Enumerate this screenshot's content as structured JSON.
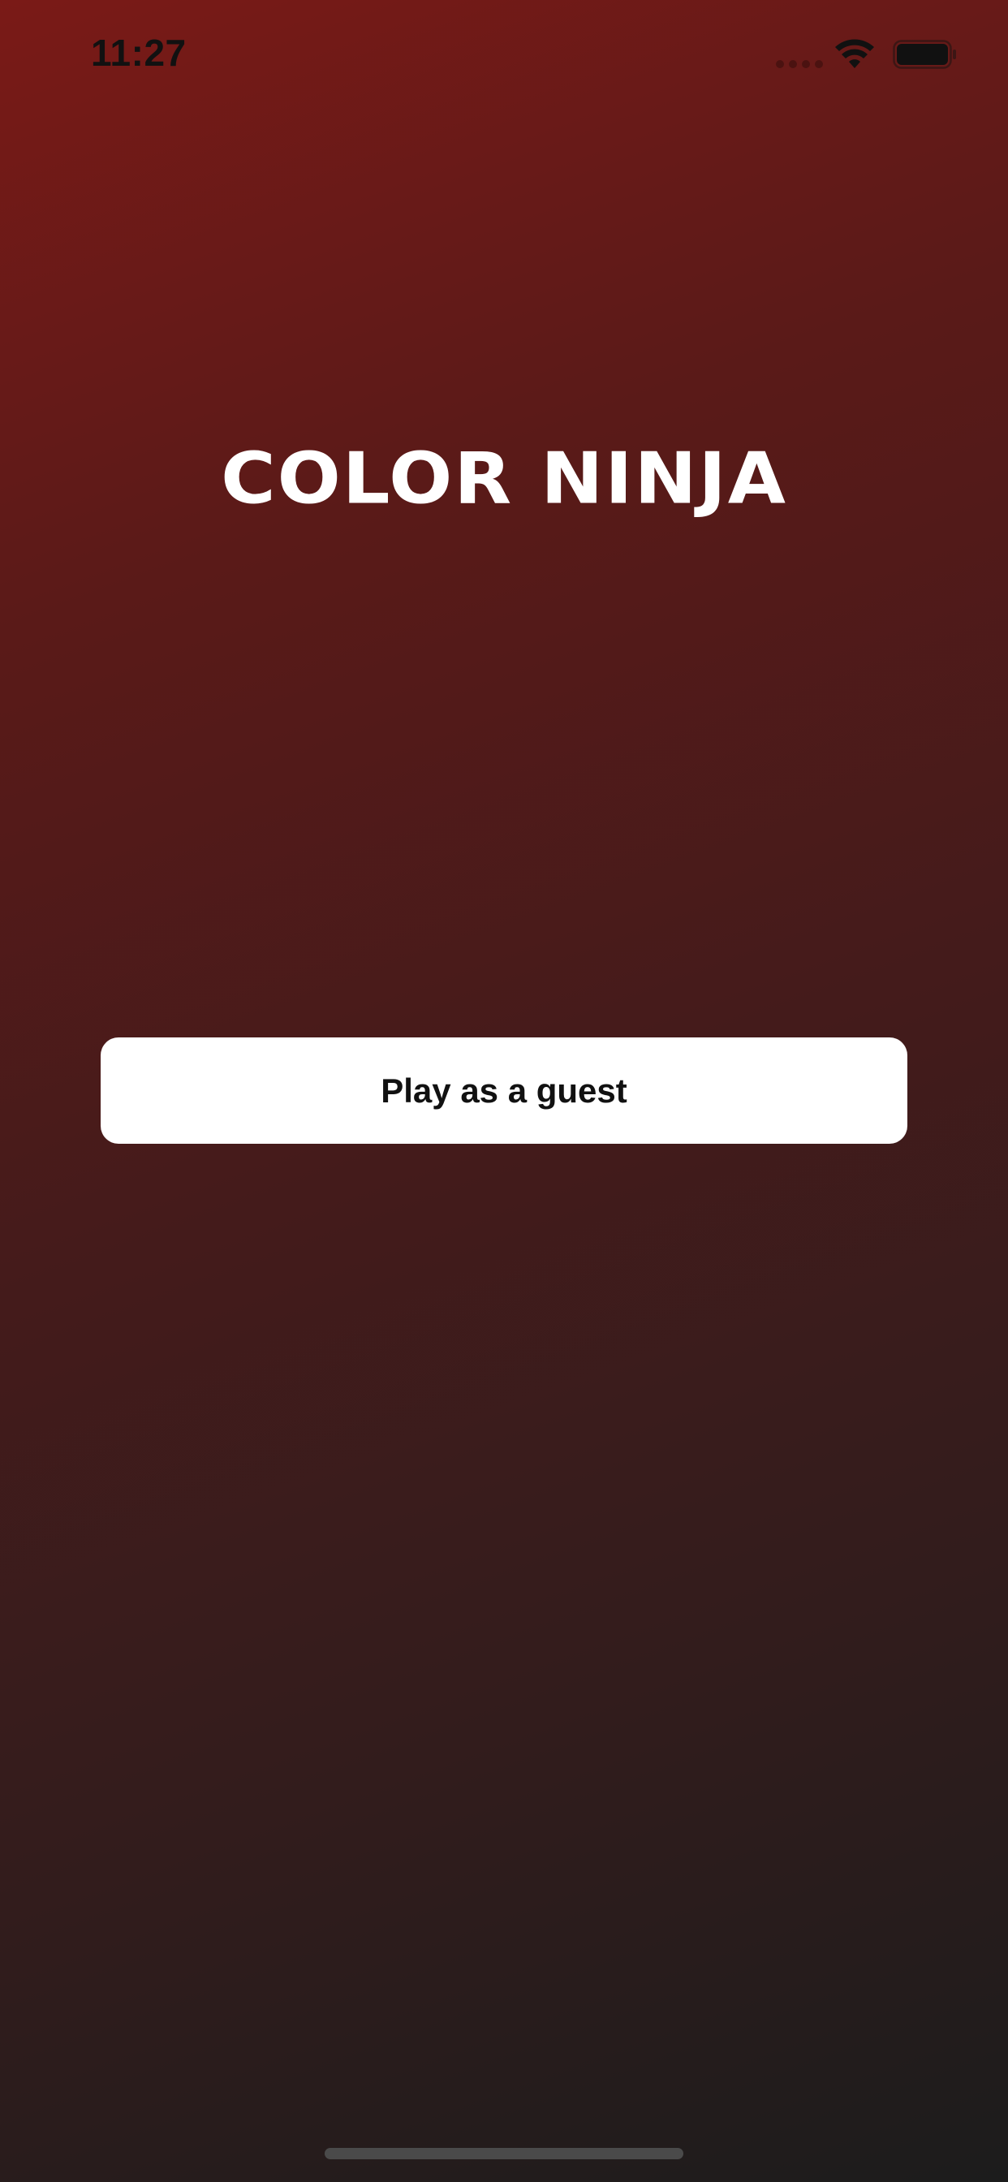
{
  "status_bar": {
    "time": "11:27",
    "icons": [
      "cellular-signal-icon",
      "wifi-icon",
      "battery-icon"
    ]
  },
  "main": {
    "title": "COLOR NINJA",
    "guest_button_label": "Play as a guest"
  },
  "colors": {
    "gradient_start": "#7a1a17",
    "gradient_end": "#1c1c1c",
    "button_background": "#ffffff",
    "button_text": "#111111",
    "title_text": "#ffffff"
  }
}
